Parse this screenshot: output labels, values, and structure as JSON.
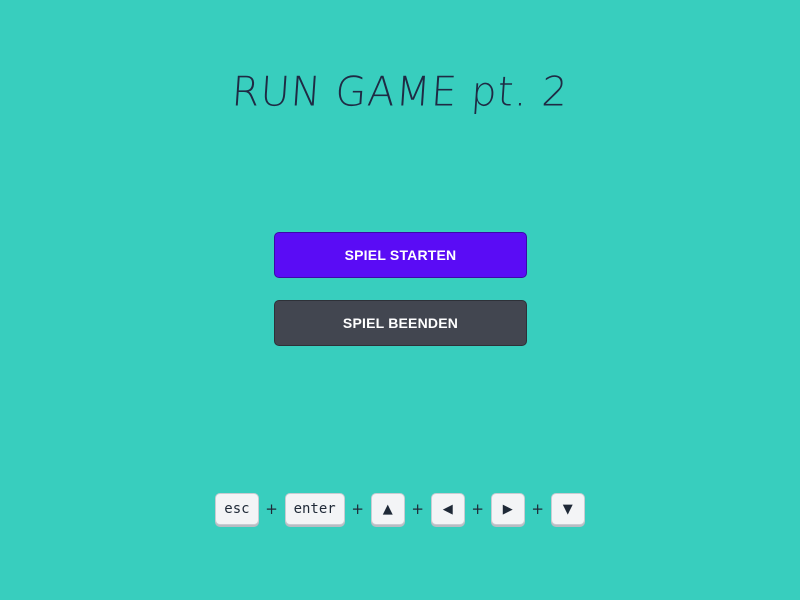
{
  "title": "RUN GAME pt. 2",
  "menu": {
    "start_label": "SPIEL STARTEN",
    "quit_label": "SPIEL BEENDEN"
  },
  "controls": {
    "separator": "+",
    "keys": [
      {
        "label": "esc",
        "icon": "esc-key"
      },
      {
        "label": "enter",
        "icon": "enter-key"
      },
      {
        "label": "▲",
        "icon": "arrow-up-icon"
      },
      {
        "label": "◀",
        "icon": "arrow-left-icon"
      },
      {
        "label": "▶",
        "icon": "arrow-right-icon"
      },
      {
        "label": "▼",
        "icon": "arrow-down-icon"
      }
    ]
  },
  "colors": {
    "background": "#38cebe",
    "start_button": "#5a0cf5",
    "quit_button": "#424650",
    "title_text": "#1f2a44"
  }
}
